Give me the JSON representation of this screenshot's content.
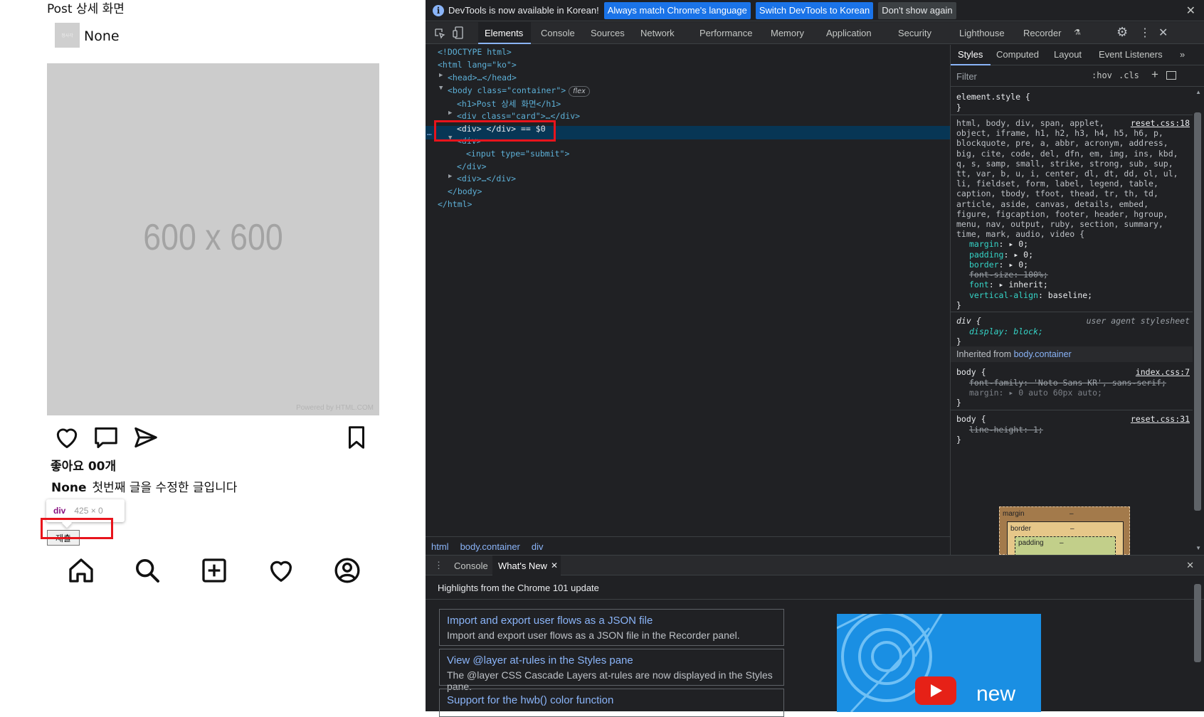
{
  "page": {
    "title": "Post 상세 화면",
    "avatar_text": "정사각",
    "username": "None",
    "photo_size": "600 x 600",
    "photo_credit": "Powered by HTML.COM",
    "likes": "좋아요 00개",
    "caption_user": "None",
    "caption_text": "첫번째 글을 수정한 글입니다",
    "tooltip_tag": "div",
    "tooltip_dims": "425 × 0",
    "submit_label": "제출",
    "icons": [
      "heart-icon",
      "comment-icon",
      "send-icon",
      "bookmark-icon",
      "home-icon",
      "search-icon",
      "add-post-icon",
      "activity-heart-icon",
      "profile-icon"
    ]
  },
  "devtools": {
    "infobar": {
      "message": "DevTools is now available in Korean!",
      "btn_match": "Always match Chrome's language",
      "btn_switch": "Switch DevTools to Korean",
      "btn_dismiss": "Don't show again"
    },
    "tabs": [
      "Elements",
      "Console",
      "Sources",
      "Network",
      "Performance",
      "Memory",
      "Application",
      "Security",
      "Lighthouse",
      "Recorder"
    ],
    "dom": {
      "doctype": "<!DOCTYPE html>",
      "html_open": "<html lang=\"ko\">",
      "head": "<head>…</head>",
      "body_open": "<body class=\"container\">",
      "flex_badge": "flex",
      "h1": "<h1>Post 상세 화면</h1>",
      "div_card": "<div class=\"card\">…</div>",
      "div_selected": "<div> </div> == $0",
      "div_open": "<div>",
      "input": "<input type=\"submit\">",
      "div_close": "</div>",
      "div_collapsed": "<div>…</div>",
      "body_close": "</body>",
      "html_close": "</html>"
    },
    "breadcrumbs": [
      "html",
      "body.container",
      "div"
    ],
    "styles_tabs": [
      "Styles",
      "Computed",
      "Layout",
      "Event Listeners"
    ],
    "filter_placeholder": "Filter",
    "hov": ":hov",
    "cls": ".cls",
    "styles": {
      "element_style": "element.style {",
      "close": "}",
      "reset_selector": "html, body, div, span, applet,\nobject, iframe, h1, h2, h3, h4, h5, h6, p,\nblockquote, pre, a, abbr, acronym, address,\nbig, cite, code, del, dfn, em, img, ins, kbd,\nq, s, samp, small, strike, strong, sub, sup,\ntt, var, b, u, i, center, dl, dt, dd, ol, ul,\nli, fieldset, form, label, legend, table,\ncaption, tbody, tfoot, thead, tr, th, td,\narticle, aside, canvas, details, embed,\nfigure, figcaption, footer, header, hgroup,\nmenu, nav, output, ruby, section, summary,\ntime, mark, audio, video {",
      "reset_src": "reset.css:18",
      "props": [
        {
          "name": "margin",
          "value": "0;"
        },
        {
          "name": "padding",
          "value": "0;"
        },
        {
          "name": "border",
          "value": "0;"
        },
        {
          "name": "font-size",
          "value": "100%;"
        },
        {
          "name": "font",
          "value": "inherit;"
        },
        {
          "name": "vertical-align",
          "value": "baseline;"
        }
      ],
      "div_rule": "div {",
      "div_prop": "display: block;",
      "ua": "user agent stylesheet",
      "inherited_label": "Inherited from",
      "inherited_from": "body.container",
      "body_rule": "body {",
      "index_src": "index.css:7",
      "body_font_family": "font-family: 'Noto Sans KR', sans-serif;",
      "body_margin": "margin: ▸ 0 auto 60px auto;",
      "reset_src2": "reset.css:31",
      "body_line_height": "line-height: 1;",
      "box_margin": "margin",
      "box_border": "border",
      "box_padding": "padding",
      "dash": "–"
    },
    "drawer": {
      "tabs": [
        "Console",
        "What's New"
      ],
      "heading": "Highlights from the Chrome 101 update",
      "cards": [
        {
          "title": "Import and export user flows as a JSON file",
          "desc": "Import and export user flows as a JSON file in the Recorder panel."
        },
        {
          "title": "View @layer at-rules in the Styles pane",
          "desc": "The @layer CSS Cascade Layers at-rules are now displayed in the Styles pane."
        },
        {
          "title": "Support for the hwb() color function",
          "desc": ""
        }
      ],
      "video_text": "new"
    }
  },
  "colors": {
    "highlight": "#e8141c",
    "devtools_bg": "#202124",
    "selection": "#073655",
    "link": "#8ab4f8"
  }
}
